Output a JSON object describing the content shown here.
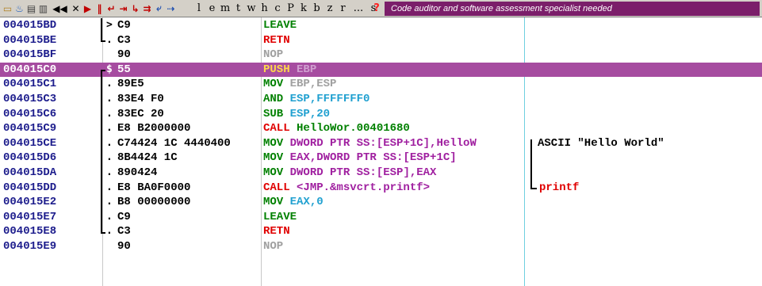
{
  "toolbar": {
    "icons": [
      {
        "name": "open-icon",
        "glyph": "▭",
        "color": "#b08020"
      },
      {
        "name": "restart-icon",
        "glyph": "♨",
        "color": "#2060c0"
      },
      {
        "name": "memory-icon",
        "glyph": "▤",
        "color": "#404040"
      },
      {
        "name": "cpu-icon",
        "glyph": "▥",
        "color": "#404040"
      },
      {
        "name": "rewind-icon",
        "glyph": "◀◀",
        "color": "#000000"
      },
      {
        "name": "close-icon",
        "glyph": "✕",
        "color": "#000000"
      },
      {
        "name": "run-icon",
        "glyph": "▶",
        "color": "#c00000"
      },
      {
        "name": "pause-icon",
        "glyph": "‖",
        "color": "#c00000"
      },
      {
        "name": "step-into-icon",
        "glyph": "↵",
        "color": "#c00000"
      },
      {
        "name": "step-over-icon",
        "glyph": "⇥",
        "color": "#c00000"
      },
      {
        "name": "trace-into-icon",
        "glyph": "↳",
        "color": "#c00000"
      },
      {
        "name": "trace-over-icon",
        "glyph": "⇉",
        "color": "#c00000"
      },
      {
        "name": "execute-till-return-icon",
        "glyph": "⤶",
        "color": "#2050b0"
      },
      {
        "name": "go-to-icon",
        "glyph": "⇢",
        "color": "#2050b0"
      }
    ],
    "letters": [
      "l",
      "e",
      "m",
      "t",
      "w",
      "h",
      "c",
      "P",
      "k",
      "b",
      "z",
      "r",
      "...",
      "s"
    ],
    "help": "?",
    "banner": "Code auditor and software assessment specialist needed"
  },
  "listing": {
    "rows": [
      {
        "addr": "004015BD",
        "mark": ">",
        "hex": "C9",
        "mnemonic": "LEAVE",
        "operands": "",
        "mn_color": "#008000",
        "op_color": "#000000",
        "comment": ""
      },
      {
        "addr": "004015BE",
        "mark": ".",
        "hex": "C3",
        "mnemonic": "RETN",
        "operands": "",
        "mn_color": "#e00000",
        "op_color": "#000000",
        "comment": ""
      },
      {
        "addr": "004015BF",
        "mark": "",
        "hex": "90",
        "mnemonic": "NOP",
        "operands": "",
        "mn_color": "#a0a0a0",
        "op_color": "#a0a0a0",
        "comment": ""
      },
      {
        "addr": "004015C0",
        "mark": "$",
        "hex": "55",
        "mnemonic": "PUSH",
        "operands": " EBP",
        "mn_color": "#ffd84a",
        "op_color": "#d0a0d0",
        "comment": ""
      },
      {
        "addr": "004015C1",
        "mark": ".",
        "hex": "89E5",
        "mnemonic": "MOV",
        "operands": " EBP,ESP",
        "mn_color": "#008000",
        "op_color": "#a0a0a0",
        "comment": ""
      },
      {
        "addr": "004015C3",
        "mark": ".",
        "hex": "83E4 F0",
        "mnemonic": "AND",
        "operands": " ESP,FFFFFFF0",
        "mn_color": "#008000",
        "op_color": "#20a0d0",
        "comment": ""
      },
      {
        "addr": "004015C6",
        "mark": ".",
        "hex": "83EC 20",
        "mnemonic": "SUB",
        "operands": " ESP,20",
        "mn_color": "#008000",
        "op_color": "#20a0d0",
        "comment": ""
      },
      {
        "addr": "004015C9",
        "mark": ".",
        "hex": "E8 B2000000",
        "mnemonic": "CALL",
        "operands": " HelloWor.00401680",
        "mn_color": "#e00000",
        "op_color": "#008000",
        "comment": ""
      },
      {
        "addr": "004015CE",
        "mark": ".",
        "hex": "C74424 1C 4440400",
        "mnemonic": "MOV",
        "operands": " DWORD PTR SS:[ESP+1C],HelloW",
        "mn_color": "#008000",
        "op_color": "#a020a0",
        "comment": "ASCII \"Hello World\""
      },
      {
        "addr": "004015D6",
        "mark": ".",
        "hex": "8B4424 1C",
        "mnemonic": "MOV",
        "operands": " EAX,DWORD PTR SS:[ESP+1C]",
        "mn_color": "#008000",
        "op_color": "#a020a0",
        "comment": ""
      },
      {
        "addr": "004015DA",
        "mark": ".",
        "hex": "890424",
        "mnemonic": "MOV",
        "operands": " DWORD PTR SS:[ESP],EAX",
        "mn_color": "#008000",
        "op_color": "#a020a0",
        "comment": ""
      },
      {
        "addr": "004015DD",
        "mark": ".",
        "hex": "E8 BA0F0000",
        "mnemonic": "CALL",
        "operands": " <JMP.&msvcrt.printf>",
        "mn_color": "#e00000",
        "op_color": "#a020a0",
        "comment": "printf"
      },
      {
        "addr": "004015E2",
        "mark": ".",
        "hex": "B8 00000000",
        "mnemonic": "MOV",
        "operands": " EAX,0",
        "mn_color": "#008000",
        "op_color": "#20a0d0",
        "comment": ""
      },
      {
        "addr": "004015E7",
        "mark": ".",
        "hex": "C9",
        "mnemonic": "LEAVE",
        "operands": "",
        "mn_color": "#008000",
        "op_color": "#000000",
        "comment": ""
      },
      {
        "addr": "004015E8",
        "mark": ".",
        "hex": "C3",
        "mnemonic": "RETN",
        "operands": "",
        "mn_color": "#e00000",
        "op_color": "#000000",
        "comment": ""
      },
      {
        "addr": "004015E9",
        "mark": "",
        "hex": "90",
        "mnemonic": "NOP",
        "operands": "",
        "mn_color": "#a0a0a0",
        "op_color": "#a0a0a0",
        "comment": ""
      }
    ],
    "selected_index": 3,
    "selected_color": "#a64ca0"
  }
}
